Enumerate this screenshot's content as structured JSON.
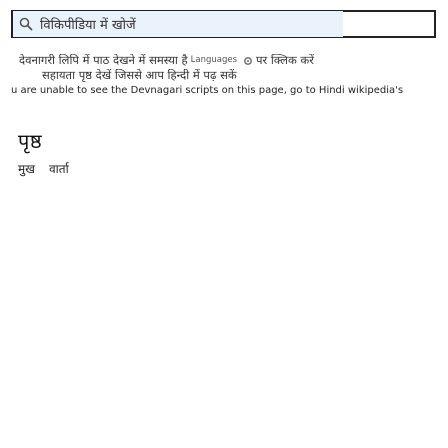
{
  "search": {
    "query": "विकिपीडिया में खोजें",
    "icon": "search-icon"
  },
  "notice": {
    "line1_part1": "देवनागरी लिपि में पाठ देखने में समस्या है",
    "line1_latin": "Languages",
    "line1_part2": "पर क्लिक करें",
    "line2": "सहायता पृष्ठ देखें जिससे आप हिन्दी में पढ़ सकें",
    "line3": "u are unable to see the Devnagari scripts on this page, go to Hindi wikipedia's"
  },
  "heading": {
    "title": "पृष्ठ"
  },
  "sub_links": {
    "first": "मुख",
    "second": "वार्ता"
  }
}
